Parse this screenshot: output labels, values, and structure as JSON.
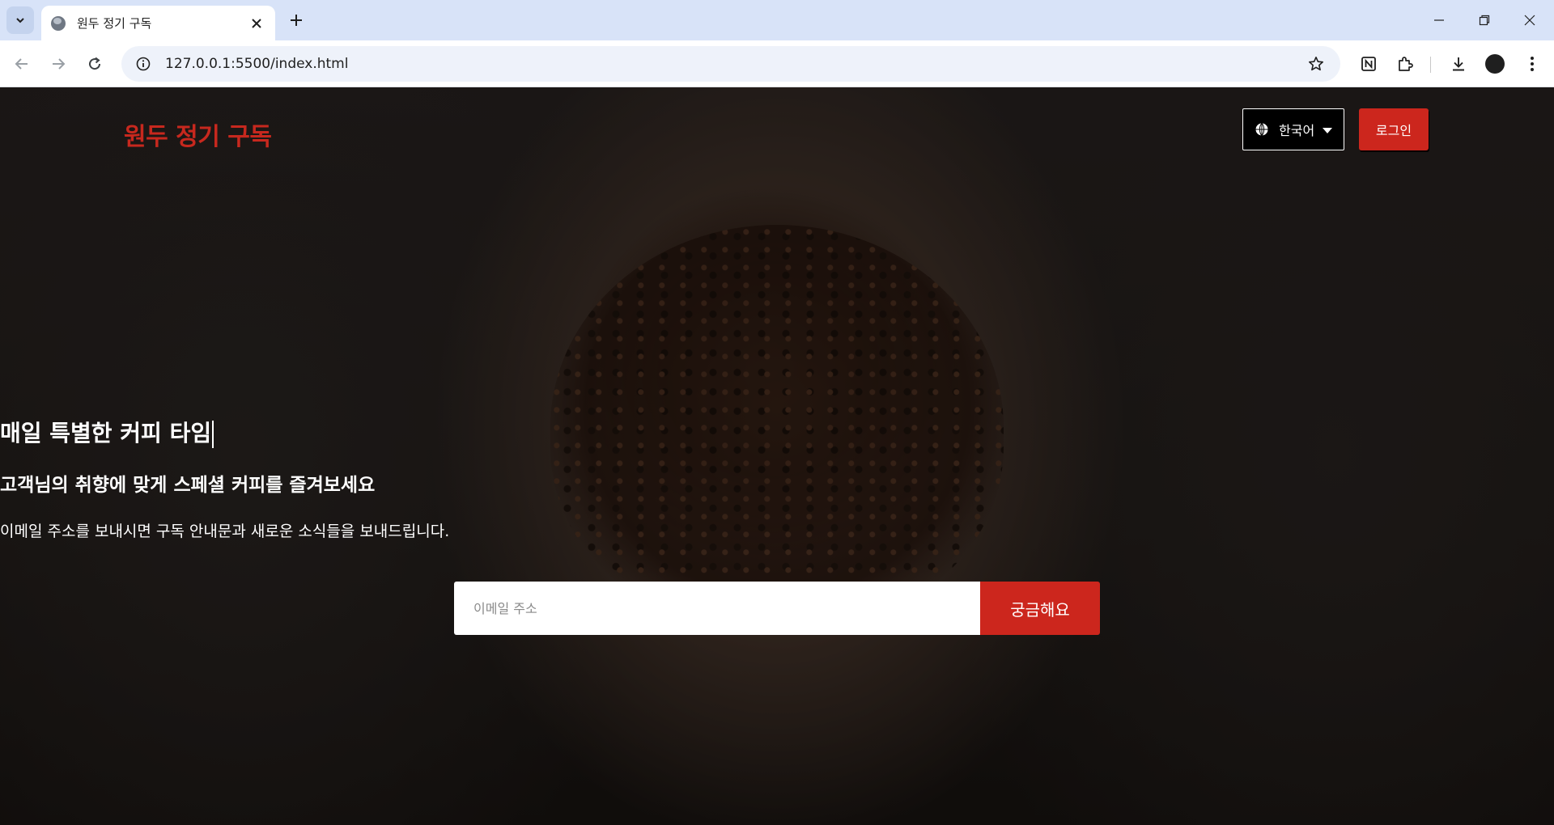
{
  "browser": {
    "tab_title": "원두 정기 구독",
    "url": "127.0.0.1:5500/index.html",
    "icons": [
      "tab-search-icon",
      "globe-favicon-icon",
      "close-icon",
      "plus-icon",
      "minimize-icon",
      "restore-icon",
      "close-window-icon",
      "back-icon",
      "forward-icon",
      "reload-icon",
      "site-info-icon",
      "star-icon",
      "notion-icon",
      "extensions-icon",
      "download-icon",
      "profile-icon",
      "more-icon"
    ]
  },
  "header": {
    "logo": "원두 정기 구독",
    "language": "한국어",
    "login_label": "로그인"
  },
  "hero": {
    "title": "매일 특별한 커피 타임",
    "subtitle": "고객님의 취향에 맞게 스페셜 커피를 즐겨보세요",
    "description": "이메일 주소를 보내시면 구독 안내문과 새로운 소식들을 보내드립니다.",
    "email_placeholder": "이메일 주소",
    "submit_label": "궁금해요"
  },
  "colors": {
    "brand_red": "#cc261d",
    "tabstrip": "#d8e3f8",
    "omnibox": "#eef2fa"
  }
}
